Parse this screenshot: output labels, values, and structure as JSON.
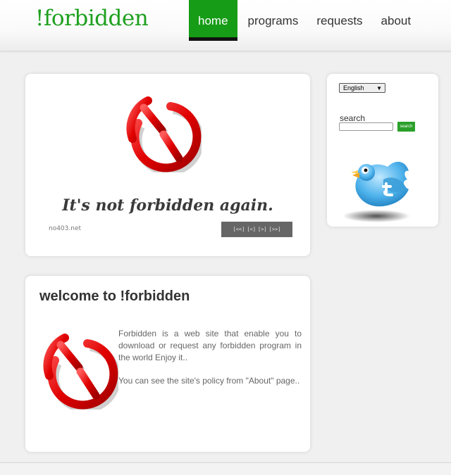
{
  "site": {
    "logo_text": "!forbidden"
  },
  "nav": {
    "items": [
      {
        "label": "home",
        "active": true
      },
      {
        "label": "programs",
        "active": false
      },
      {
        "label": "requests",
        "active": false
      },
      {
        "label": "about",
        "active": false
      }
    ]
  },
  "slider": {
    "logo_icon": "forbidden-sign-icon",
    "caption": "It's not forbidden again.",
    "site_label": "no403.net",
    "pager": {
      "first": "[<<]",
      "prev": "[<]",
      "next": "[>]",
      "last": "[>>]"
    }
  },
  "sidebar": {
    "language_selected": "English",
    "search_label": "search",
    "search_value": "",
    "search_button": "search",
    "twitter_icon": "twitter-bird-icon"
  },
  "welcome": {
    "title": "welcome to !forbidden",
    "logo_icon": "forbidden-sign-icon",
    "paragraph_1": "Forbidden is a web site that enable you to download or request any forbidden program in the world Enjoy it..",
    "paragraph_2": "You can see the site's policy from \"About\" page.."
  },
  "colors": {
    "brand_green": "#169c16",
    "logo_green": "#1ea01e",
    "sign_red": "#e01010"
  }
}
